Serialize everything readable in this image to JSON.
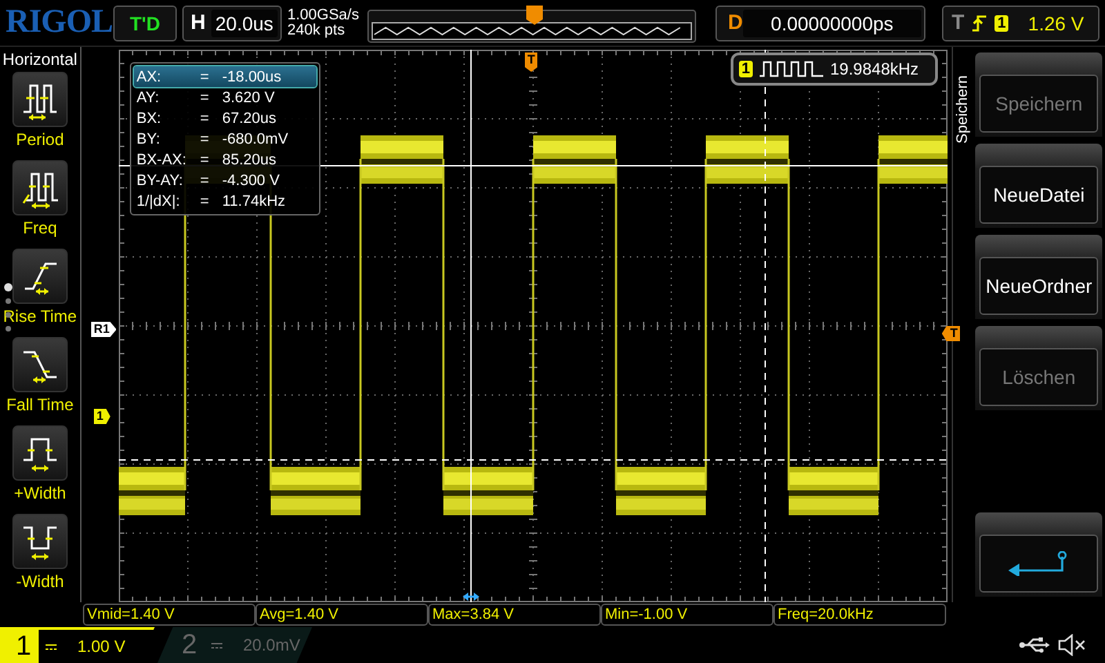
{
  "brand": "RIGOL",
  "run_status": "T'D",
  "timebase": {
    "label": "H",
    "value": "20.0us"
  },
  "sample_rate": "1.00GSa/s",
  "memory_depth": "240k pts",
  "delay": {
    "label": "D",
    "value": "0.00000000ps"
  },
  "trigger": {
    "label": "T",
    "source": "1",
    "level": "1.26 V"
  },
  "sidebar": {
    "title": "Horizontal",
    "items": [
      {
        "label": "Period",
        "kind": "period"
      },
      {
        "label": "Freq",
        "kind": "freq"
      },
      {
        "label": "Rise Time",
        "kind": "rise"
      },
      {
        "label": "Fall Time",
        "kind": "fall"
      },
      {
        "label": "+Width",
        "kind": "pos_width"
      },
      {
        "label": "-Width",
        "kind": "neg_width"
      }
    ]
  },
  "cursor_readout": [
    {
      "label": "AX:",
      "sign": "=",
      "value": "-18.00us",
      "selected": true
    },
    {
      "label": "AY:",
      "sign": "=",
      "value": "3.620 V",
      "selected": false
    },
    {
      "label": "BX:",
      "sign": "=",
      "value": "67.20us",
      "selected": false
    },
    {
      "label": "BY:",
      "sign": "=",
      "value": "-680.0mV",
      "selected": false
    },
    {
      "label": "BX-AX:",
      "sign": "=",
      "value": "85.20us",
      "selected": false
    },
    {
      "label": "BY-AY:",
      "sign": "=",
      "value": "-4.300 V",
      "selected": false
    },
    {
      "label": "1/|dX|:",
      "sign": "=",
      "value": "11.74kHz",
      "selected": false
    }
  ],
  "frequency_counter": {
    "channel": "1",
    "value": "19.9848kHz"
  },
  "markers": {
    "reference": "R1",
    "channel": "1",
    "trigger_level": "T",
    "trigger_position": "T"
  },
  "menu": {
    "title": "Speichern",
    "buttons": [
      {
        "kind": "text",
        "label": "Speichern",
        "disabled": true
      },
      {
        "kind": "text",
        "label": "NeueDatei",
        "disabled": false
      },
      {
        "kind": "text",
        "label": "NeueOrdner",
        "disabled": false
      },
      {
        "kind": "text",
        "label": "Löschen",
        "disabled": true
      },
      {
        "kind": "back",
        "disabled": false
      }
    ]
  },
  "measurements": [
    "Vmid=1.40 V",
    "Avg=1.40 V",
    "Max=3.84 V",
    "Min=-1.00 V",
    "Freq=20.0kHz"
  ],
  "channels": [
    {
      "number": "1",
      "scale": "1.00 V",
      "selected": true
    },
    {
      "number": "2",
      "scale": "20.0mV",
      "selected": false
    }
  ]
}
